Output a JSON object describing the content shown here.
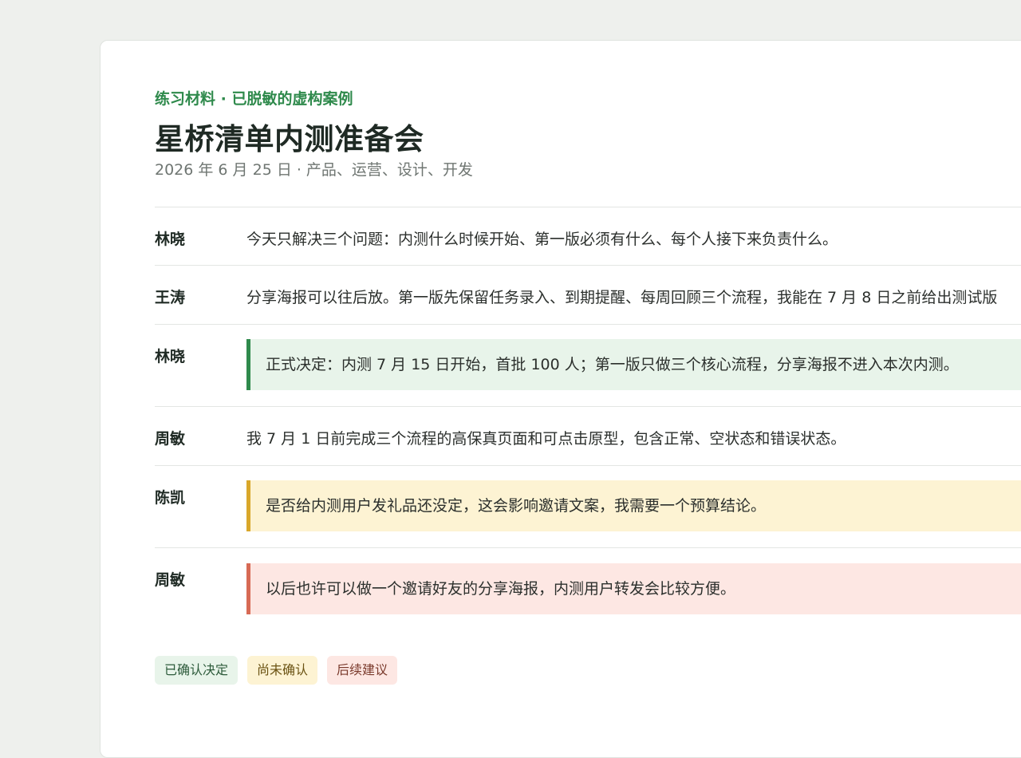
{
  "header": {
    "eyebrow": "练习材料 · 已脱敏的虚构案例",
    "title": "星桥清单内测准备会",
    "meta": "2026 年 6 月 25 日 · 产品、运营、设计、开发"
  },
  "transcript": [
    {
      "speaker": "林晓",
      "text": "今天只解决三个问题：内测什么时候开始、第一版必须有什么、每个人接下来负责什么。",
      "kind": "plain"
    },
    {
      "speaker": "王涛",
      "text": "分享海报可以往后放。第一版先保留任务录入、到期提醒、每周回顾三个流程，我能在 7 月 8 日之前给出测试版",
      "kind": "plain"
    },
    {
      "speaker": "林晓",
      "text": "正式决定：内测 7 月 15 日开始，首批 100 人；第一版只做三个核心流程，分享海报不进入本次内测。",
      "kind": "decision"
    },
    {
      "speaker": "周敏",
      "text": "我 7 月 1 日前完成三个流程的高保真页面和可点击原型，包含正常、空状态和错误状态。",
      "kind": "plain"
    },
    {
      "speaker": "陈凯",
      "text": "是否给内测用户发礼品还没定，这会影响邀请文案，我需要一个预算结论。",
      "kind": "pending"
    },
    {
      "speaker": "周敏",
      "text": "以后也许可以做一个邀请好友的分享海报，内测用户转发会比较方便。",
      "kind": "suggest"
    }
  ],
  "legend": {
    "confirmed": "已确认决定",
    "pending": "尚未确认",
    "suggest": "后续建议"
  },
  "colors": {
    "accent_green": "#2f8a4c",
    "pending_yellow": "#d9a72a",
    "suggest_red": "#d76a55"
  }
}
